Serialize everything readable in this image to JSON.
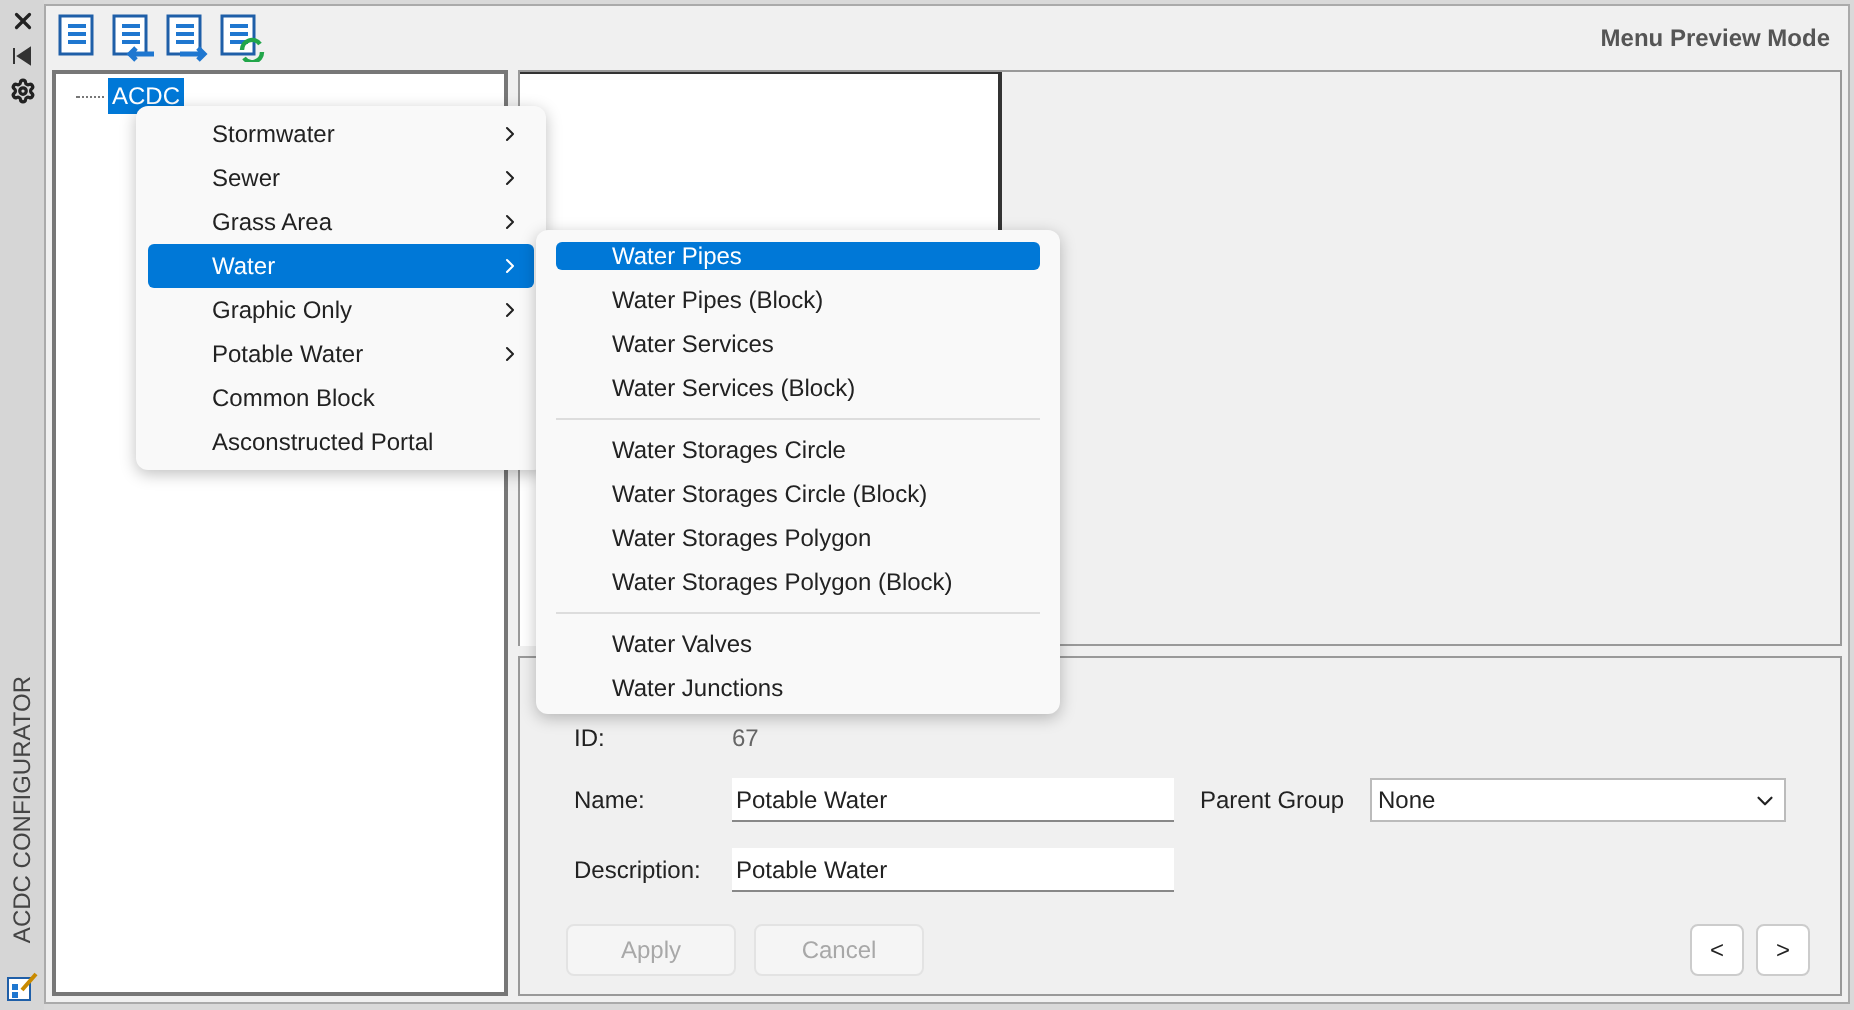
{
  "side_strip": {
    "title": "ACDC CONFIGURATOR"
  },
  "toolbar": {
    "mode_label": "Menu Preview Mode"
  },
  "tree": {
    "items": [
      {
        "label": "ACDC",
        "selected": true
      }
    ]
  },
  "context_menu": {
    "items": [
      {
        "label": "Stormwater",
        "has_submenu": true,
        "selected": false
      },
      {
        "label": "Sewer",
        "has_submenu": true,
        "selected": false
      },
      {
        "label": "Grass Area",
        "has_submenu": true,
        "selected": false
      },
      {
        "label": "Water",
        "has_submenu": true,
        "selected": true
      },
      {
        "label": "Graphic Only",
        "has_submenu": true,
        "selected": false
      },
      {
        "label": "Potable Water",
        "has_submenu": true,
        "selected": false
      },
      {
        "label": "Common Block",
        "has_submenu": false,
        "selected": false
      },
      {
        "label": "Asconstructed Portal",
        "has_submenu": false,
        "selected": false
      }
    ]
  },
  "submenu": {
    "items": [
      {
        "kind": "item",
        "label": "Water Pipes",
        "selected": true
      },
      {
        "kind": "item",
        "label": "Water Pipes (Block)",
        "selected": false
      },
      {
        "kind": "item",
        "label": "Water Services",
        "selected": false
      },
      {
        "kind": "item",
        "label": "Water Services (Block)",
        "selected": false
      },
      {
        "kind": "separator"
      },
      {
        "kind": "item",
        "label": "Water Storages Circle",
        "selected": false
      },
      {
        "kind": "item",
        "label": "Water Storages Circle (Block)",
        "selected": false
      },
      {
        "kind": "item",
        "label": "Water Storages Polygon",
        "selected": false
      },
      {
        "kind": "item",
        "label": "Water Storages Polygon (Block)",
        "selected": false
      },
      {
        "kind": "separator"
      },
      {
        "kind": "item",
        "label": "Water Valves",
        "selected": false
      },
      {
        "kind": "item",
        "label": "Water Junctions",
        "selected": false
      }
    ]
  },
  "form": {
    "id_label": "ID:",
    "id_value": "67",
    "name_label": "Name:",
    "name_value": "Potable Water",
    "parent_label": "Parent Group",
    "parent_value": "None",
    "description_label": "Description:",
    "description_value": "Potable Water",
    "buttons": [
      {
        "label": "Apply",
        "disabled": true
      },
      {
        "label": "Cancel",
        "disabled": true
      }
    ],
    "nav_buttons": [
      "<",
      ">"
    ]
  }
}
